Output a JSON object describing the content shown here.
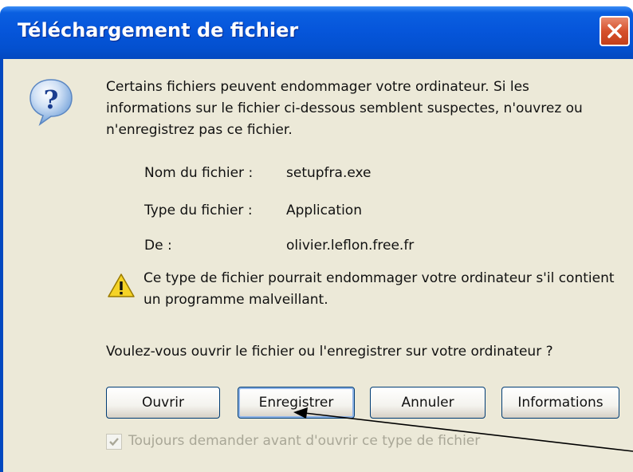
{
  "window": {
    "title": "Téléchargement de fichier"
  },
  "icons": {
    "close": "close-icon",
    "question": "question-icon",
    "warning": "warning-icon",
    "checkmark": "checkmark-icon"
  },
  "message": "Certains fichiers peuvent endommager votre ordinateur. Si les informations sur le fichier ci-dessous semblent suspectes, n'ouvrez ou n'enregistrez pas ce fichier.",
  "file_info": {
    "name_label": "Nom du fichier :",
    "name_value": "setupfra.exe",
    "type_label": "Type du fichier :",
    "type_value": "Application",
    "from_label": "De :",
    "from_value": "olivier.leflon.free.fr"
  },
  "warning_text": "Ce type de fichier pourrait endommager votre ordinateur s'il contient un programme malveillant.",
  "question": "Voulez-vous ouvrir le fichier ou l'enregistrer sur votre ordinateur ?",
  "buttons": {
    "open": "Ouvrir",
    "save": "Enregistrer",
    "cancel": "Annuler",
    "info": "Informations"
  },
  "always_ask": {
    "label": "Toujours demander avant d'ouvrir ce type de fichier",
    "checked": true
  },
  "colors": {
    "titlebar": "#0656db",
    "client_bg": "#ece9d8",
    "close_button": "#d6512c",
    "disabled_text": "#a9a797"
  }
}
